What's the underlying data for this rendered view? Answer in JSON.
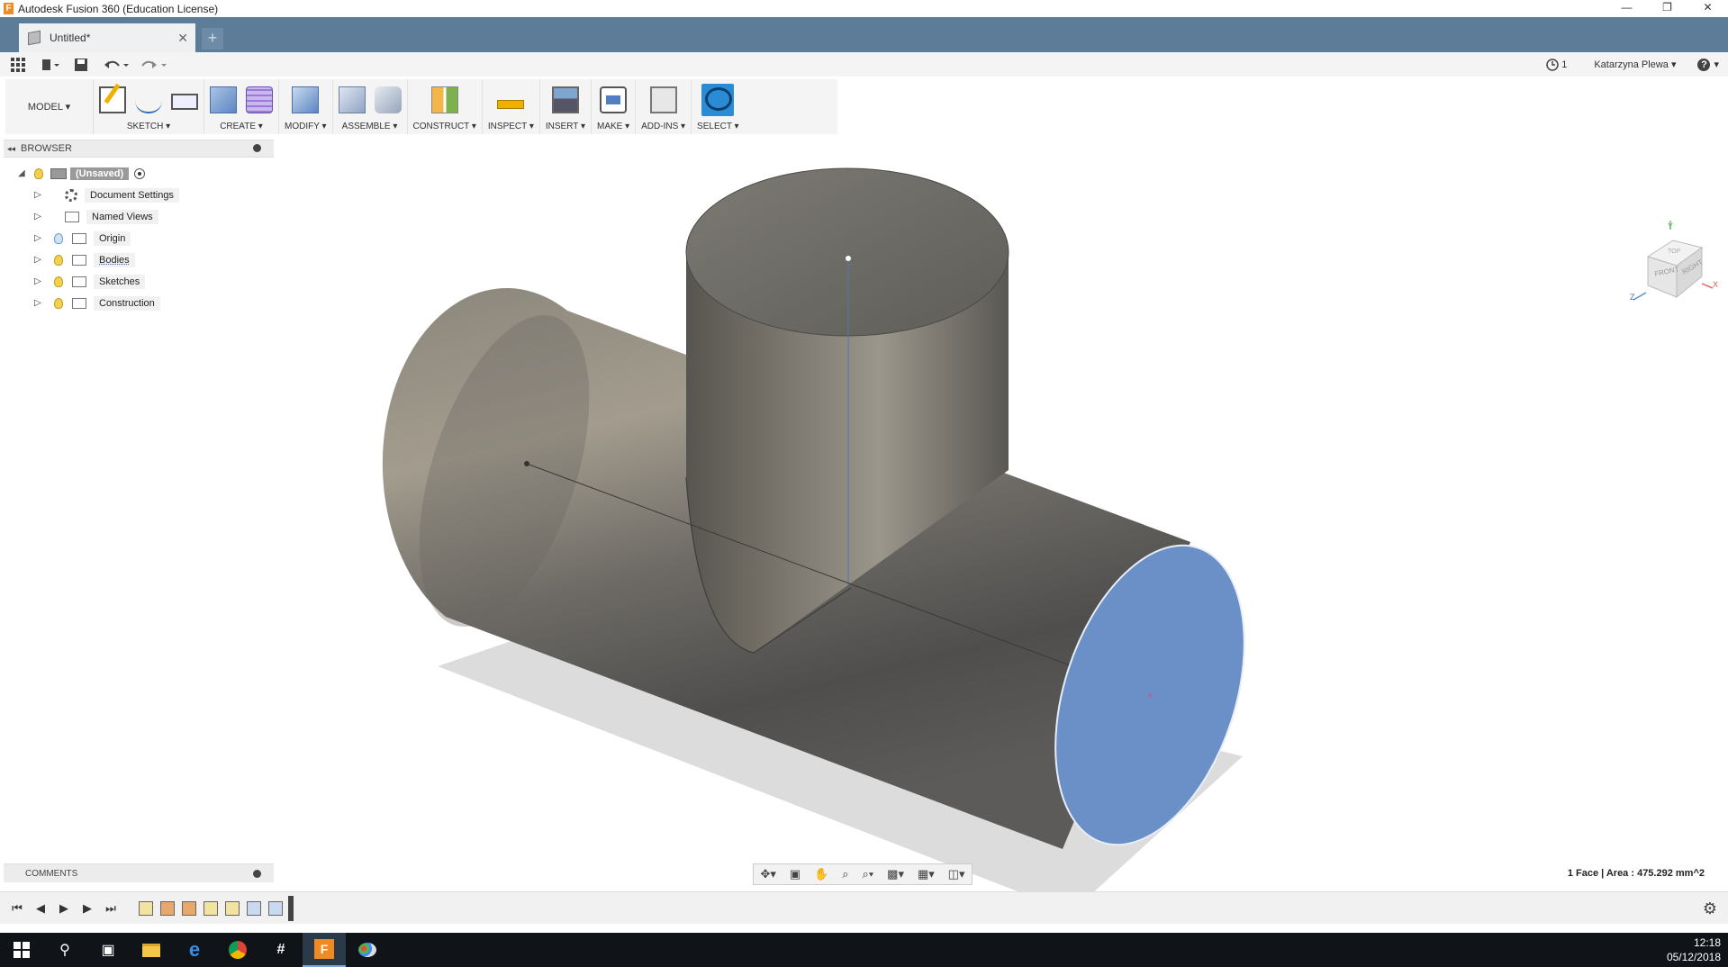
{
  "app": {
    "title": "Autodesk Fusion 360 (Education License)",
    "app_icon_letter": "F"
  },
  "window_buttons": [
    "—",
    "❐",
    "✕"
  ],
  "tabs": [
    {
      "label": "Untitled*",
      "close": "✕"
    }
  ],
  "new_tab": "+",
  "quickbar": {
    "job_count": "1",
    "user": "Katarzyna Plewa ▾",
    "help": "?",
    "help_caret": "▾"
  },
  "toolbar": {
    "workspace": "MODEL ▾",
    "groups": [
      {
        "label": "SKETCH ▾"
      },
      {
        "label": "CREATE ▾"
      },
      {
        "label": "MODIFY ▾"
      },
      {
        "label": "ASSEMBLE ▾"
      },
      {
        "label": "CONSTRUCT ▾"
      },
      {
        "label": "INSPECT ▾"
      },
      {
        "label": "INSERT ▾"
      },
      {
        "label": "MAKE ▾"
      },
      {
        "label": "ADD-INS ▾"
      },
      {
        "label": "SELECT ▾"
      }
    ]
  },
  "browser": {
    "title": "BROWSER",
    "collapse": "◂◂",
    "root": "(Unsaved)",
    "items": [
      {
        "label": "Document Settings",
        "icon": "gear-icon"
      },
      {
        "label": "Named Views",
        "icon": "folder-icon"
      },
      {
        "label": "Origin",
        "icon": "folder-icon"
      },
      {
        "label": "Bodies",
        "icon": "folder-icon"
      },
      {
        "label": "Sketches",
        "icon": "folder-icon"
      },
      {
        "label": "Construction",
        "icon": "folder-icon"
      }
    ]
  },
  "viewcube": {
    "front": "FRONT",
    "right": "RIGHT",
    "top": "TOP",
    "x": "X",
    "y": "Y",
    "z": "Z"
  },
  "comments": {
    "title": "COMMENTS"
  },
  "status": "1 Face | Area : 475.292 mm^2",
  "nav_icons": [
    "orbit-icon",
    "look-at-icon",
    "pan-icon",
    "zoom-icon",
    "zoom-window-icon",
    "display-settings-icon",
    "grid-icon",
    "viewports-icon"
  ],
  "timeline": {
    "controls": [
      "⏮",
      "◀",
      "▶",
      "▶",
      "⏭"
    ]
  },
  "taskbar": {
    "time": "12:18",
    "date": "05/12/2018"
  },
  "colors": {
    "tabbar": "#5d7c98",
    "selected_face": "#6b8fc7",
    "body": "#6f6c66",
    "select_tool": "#2a8bd6"
  }
}
